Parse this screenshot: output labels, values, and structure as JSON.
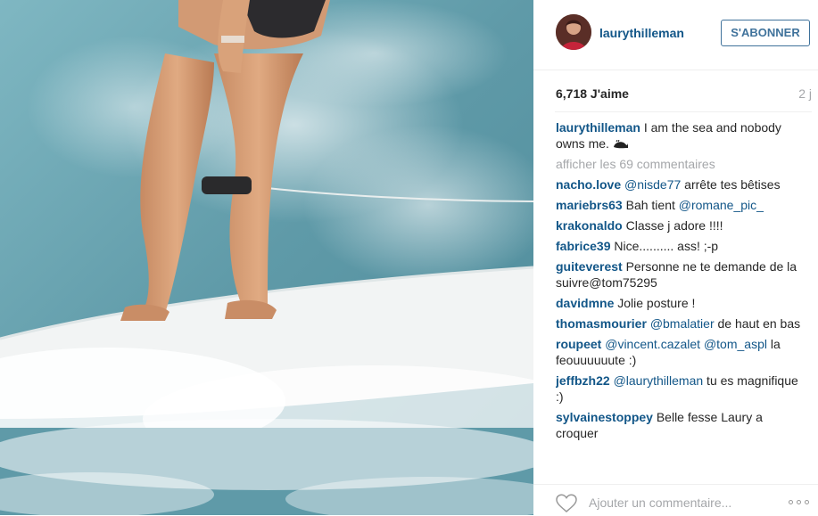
{
  "post": {
    "username": "laurythilleman",
    "follow_label": "S'ABONNER",
    "likes": "6,718 J'aime",
    "time": "2 j",
    "caption": {
      "user": "laurythilleman",
      "text": "I am the sea and nobody owns me.",
      "emoji": "whale-emoji"
    },
    "view_comments": "afficher les 69 commentaires"
  },
  "comments": [
    {
      "user": "nacho.love",
      "mention": "@nisde77",
      "text": " arrête tes bêtises"
    },
    {
      "user": "mariebrs63",
      "text": "Bah tient ",
      "mention": "@romane_pic_"
    },
    {
      "user": "krakonaldo",
      "text": "Classe j adore !!!!"
    },
    {
      "user": "fabrice39",
      "text": "Nice.......... ass! ;-p"
    },
    {
      "user": "guiteverest",
      "text": "Personne ne te demande de la suivre@tom75295"
    },
    {
      "user": "davidmne",
      "text": "Jolie posture !"
    },
    {
      "user": "thomasmourier",
      "mention": "@bmalatier",
      "text": " de haut en bas"
    },
    {
      "user": "roupeet",
      "mention": "@vincent.cazalet",
      "mention2": "@tom_aspl",
      "text": " la feouuuuuute :)"
    },
    {
      "user": "jeffbzh22",
      "mention": "@laurythilleman",
      "text": " tu es magnifique :)"
    },
    {
      "user": "sylvainestoppey",
      "text": "Belle fesse Laury a croquer"
    }
  ],
  "footer": {
    "placeholder": "Ajouter un commentaire...",
    "like_icon": "heart-outline-icon",
    "more_icon": "more-options-icon"
  },
  "colors": {
    "link": "#125688",
    "button": "#3f729b",
    "muted": "#a5a7aa",
    "sea": "#6aa6b3"
  }
}
